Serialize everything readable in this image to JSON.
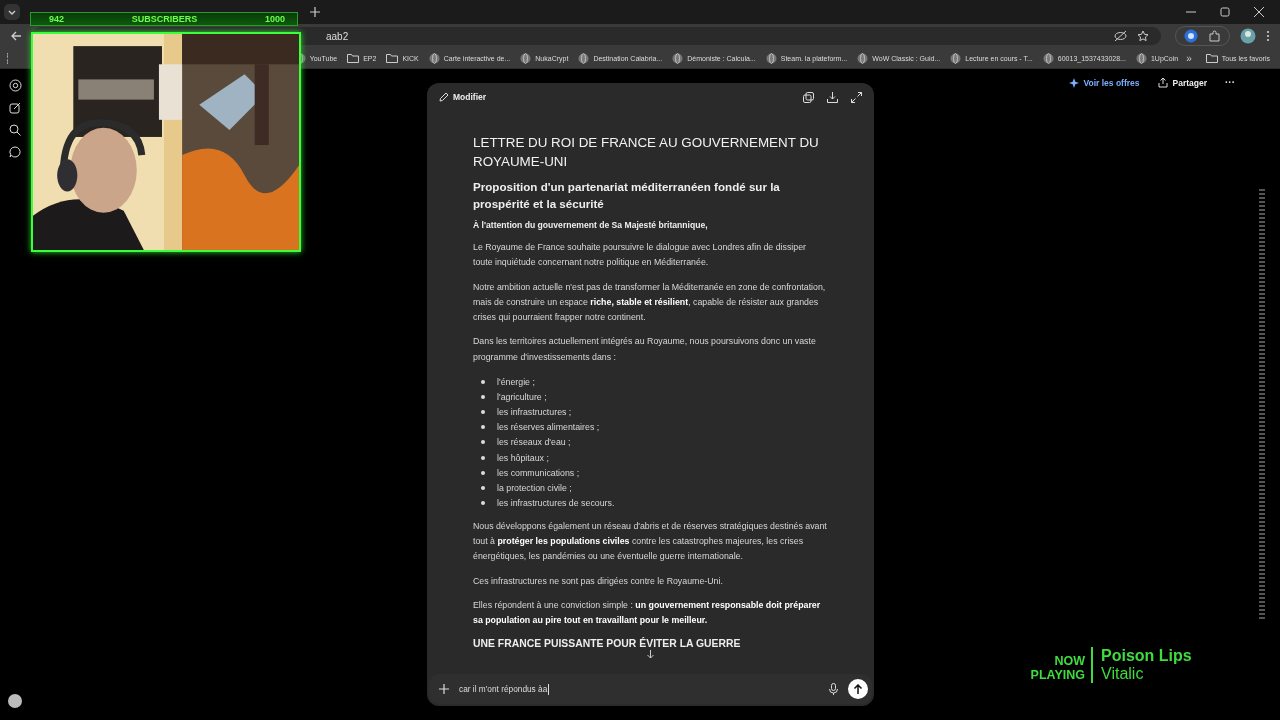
{
  "browser": {
    "address": "aab2",
    "bookmarks": [
      {
        "label": "YouTube",
        "kind": "site"
      },
      {
        "label": "EP2",
        "kind": "folder"
      },
      {
        "label": "KICK",
        "kind": "folder"
      },
      {
        "label": "Carte interactive de...",
        "kind": "site"
      },
      {
        "label": "NukaCrypt",
        "kind": "site"
      },
      {
        "label": "Destination Calabria...",
        "kind": "site"
      },
      {
        "label": "Démoniste : Calcula...",
        "kind": "site"
      },
      {
        "label": "Steam. la plateform...",
        "kind": "site"
      },
      {
        "label": "WoW Classic : Guid...",
        "kind": "site"
      },
      {
        "label": "Lecture en cours - T...",
        "kind": "site"
      },
      {
        "label": "60013_1537433028...",
        "kind": "site"
      },
      {
        "label": "1UpCoin",
        "kind": "site"
      }
    ],
    "more": "»",
    "all_bookmarks": "Tous les favoris"
  },
  "overlay": {
    "current": "942",
    "label": "SUBSCRIBERS",
    "goal": "1000"
  },
  "header": {
    "offers": "Voir les offres",
    "share": "Partager",
    "menu": "···"
  },
  "canvas": {
    "edit": "Modifier",
    "blocks": [
      {
        "kind": "h1",
        "text": "LETTRE DU ROI DE FRANCE AU GOUVERNEMENT DU ROYAUME-UNI"
      },
      {
        "kind": "h2",
        "text": "Proposition d'un partenariat méditerranéen fondé sur la prospérité et la sécurité"
      },
      {
        "kind": "lead",
        "text": "À l'attention du gouvernement de Sa Majesté britannique,"
      },
      {
        "kind": "p",
        "text": "Le Royaume de France souhaite poursuivre le dialogue avec Londres afin de dissiper toute inquiétude concernant notre politique en Méditerranée."
      },
      {
        "kind": "p",
        "text": "Notre ambition actuelle n'est pas de transformer la Méditerranée en zone de confrontation, mais de construire un espace **riche, stable et résilient**, capable de résister aux grandes crises qui pourraient frapper notre continent."
      },
      {
        "kind": "p",
        "text": "Dans les territoires actuellement intégrés au Royaume, nous poursuivons donc un vaste programme d'investissements dans :"
      },
      {
        "kind": "list",
        "items": [
          "l'énergie ;",
          "l'agriculture ;",
          "les infrastructures ;",
          "les réserves alimentaires ;",
          "les réseaux d'eau ;",
          "les hôpitaux ;",
          "les communications ;",
          "la protection civile ;",
          "les infrastructures de secours."
        ]
      },
      {
        "kind": "p",
        "text": "Nous développons également un réseau d'abris et de réserves stratégiques destinés avant tout à **protéger les populations civiles** contre les catastrophes majeures, les crises énergétiques, les pandémies ou une éventuelle guerre internationale."
      },
      {
        "kind": "p",
        "text": "Ces infrastructures ne sont pas dirigées contre le Royaume-Uni."
      },
      {
        "kind": "p",
        "text": "Elles répondent à une conviction simple : **un gouvernement responsable doit préparer sa population au pire tout en travaillant pour le meilleur.**"
      },
      {
        "kind": "h3",
        "text": "UNE FRANCE PUISSANTE POUR ÉVITER LA GUERRE"
      }
    ]
  },
  "composer": {
    "value": "car il m'ont répondus àa"
  },
  "now_playing": {
    "label": "NOW PLAYING",
    "title": "Poison Lips",
    "artist": "Vitalic"
  }
}
